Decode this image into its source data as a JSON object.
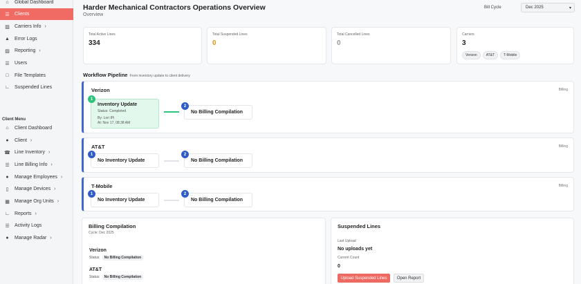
{
  "sidebar": {
    "top_items": [
      {
        "label": "Global Dashboard",
        "icon": "home-icon"
      },
      {
        "label": "Clients",
        "icon": "list-icon",
        "active": true
      },
      {
        "label": "Carriers Info",
        "icon": "signal-icon",
        "chevron": true
      },
      {
        "label": "Error Logs",
        "icon": "warning-icon"
      },
      {
        "label": "Reporting",
        "icon": "signal-icon",
        "chevron": true
      },
      {
        "label": "Users",
        "icon": "list-icon"
      },
      {
        "label": "File Templates",
        "icon": "file-icon"
      },
      {
        "label": "Suspended Lines",
        "icon": "chart-icon"
      }
    ],
    "client_menu_title": "Client Menu",
    "client_items": [
      {
        "label": "Client Dashboard",
        "icon": "home-icon"
      },
      {
        "label": "Client",
        "icon": "user-icon",
        "chevron": true
      },
      {
        "label": "Line Inventory",
        "icon": "phone-icon",
        "chevron": true
      },
      {
        "label": "Line Billing Info",
        "icon": "list-icon",
        "chevron": true
      },
      {
        "label": "Manage Employees",
        "icon": "users-icon",
        "chevron": true
      },
      {
        "label": "Manage Devices",
        "icon": "device-icon",
        "chevron": true
      },
      {
        "label": "Manage Org Units",
        "icon": "org-icon",
        "chevron": true
      },
      {
        "label": "Reports",
        "icon": "report-icon",
        "chevron": true
      },
      {
        "label": "Activity Logs",
        "icon": "list-icon"
      },
      {
        "label": "Manage Radar",
        "icon": "user-icon",
        "chevron": true
      }
    ]
  },
  "header": {
    "title": "Harder Mechanical Contractors Operations Overview",
    "subtitle": "Overview",
    "bill_cycle_label": "Bill Cycle",
    "bill_cycle_value": "Dec 2025"
  },
  "stats": {
    "active": {
      "label": "Total Active Lines",
      "value": "334"
    },
    "suspended": {
      "label": "Total Suspended Lines",
      "value": "0"
    },
    "cancelled": {
      "label": "Total Cancelled Lines",
      "value": "0"
    },
    "carriers": {
      "label": "Carriers",
      "value": "3",
      "chips": [
        "Verizon",
        "AT&T",
        "T-Mobile"
      ]
    }
  },
  "workflow": {
    "title": "Workflow Pipeline",
    "hint": "From inventory update to client delivery",
    "billing_label": "Billing",
    "rows": [
      {
        "carrier": "Verizon",
        "step1": {
          "num": "1",
          "title": "Inventory Update",
          "status": "Status: Completed",
          "by": "By: Lori IPi",
          "at": "At: Nov 17, 08:38 AM"
        },
        "step2": {
          "num": "2",
          "title": "No Billing Compilation"
        }
      },
      {
        "carrier": "AT&T",
        "step1": {
          "num": "1",
          "title": "No Inventory Update"
        },
        "step2": {
          "num": "2",
          "title": "No Billing Compilation"
        }
      },
      {
        "carrier": "T-Mobile",
        "step1": {
          "num": "1",
          "title": "No Inventory Update"
        },
        "step2": {
          "num": "2",
          "title": "No Billing Compilation"
        }
      }
    ]
  },
  "billing_compilation": {
    "title": "Billing Compilation",
    "cycle": "Cycle: Dec 2025",
    "status_label": "Status:",
    "carriers": [
      {
        "name": "Verizon",
        "status": "No Billing Compilation"
      },
      {
        "name": "AT&T",
        "status": "No Billing Compilation"
      }
    ]
  },
  "suspended_panel": {
    "title": "Suspended Lines",
    "last_upload_label": "Last Upload",
    "last_upload_value": "No uploads yet",
    "current_count_label": "Current Count",
    "current_count_value": "0",
    "upload_button": "Upload Suspended Lines",
    "open_report_button": "Open Report"
  },
  "colors": {
    "accent_red": "#f06b63",
    "pipeline_blue": "#3f66c9",
    "done_green": "#2fc27a",
    "warning_orange": "#e3941a"
  }
}
